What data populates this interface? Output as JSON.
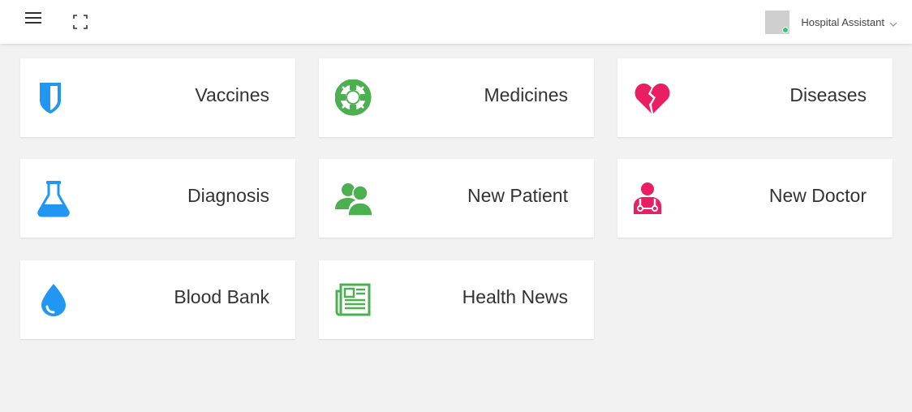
{
  "header": {
    "user_name": "Hospital Assistant"
  },
  "icons": {
    "menu": "hamburger-icon",
    "fullscreen": "fullscreen-icon",
    "caret": "chevron-down-icon"
  },
  "colors": {
    "blue": "#2196f3",
    "green": "#4caf50",
    "pink": "#e91e63",
    "background": "#f2f2f2",
    "online": "#2ecc71"
  },
  "cards": [
    {
      "label": "Vaccines",
      "icon": "shield-icon",
      "color": "#2196f3"
    },
    {
      "label": "Medicines",
      "icon": "lifebuoy-icon",
      "color": "#4caf50"
    },
    {
      "label": "Diseases",
      "icon": "broken-heart-icon",
      "color": "#e91e63"
    },
    {
      "label": "Diagnosis",
      "icon": "flask-icon",
      "color": "#2196f3"
    },
    {
      "label": "New Patient",
      "icon": "users-icon",
      "color": "#4caf50"
    },
    {
      "label": "New Doctor",
      "icon": "doctor-icon",
      "color": "#e91e63"
    },
    {
      "label": "Blood Bank",
      "icon": "drop-icon",
      "color": "#2196f3"
    },
    {
      "label": "Health News",
      "icon": "newspaper-icon",
      "color": "#4caf50"
    }
  ]
}
